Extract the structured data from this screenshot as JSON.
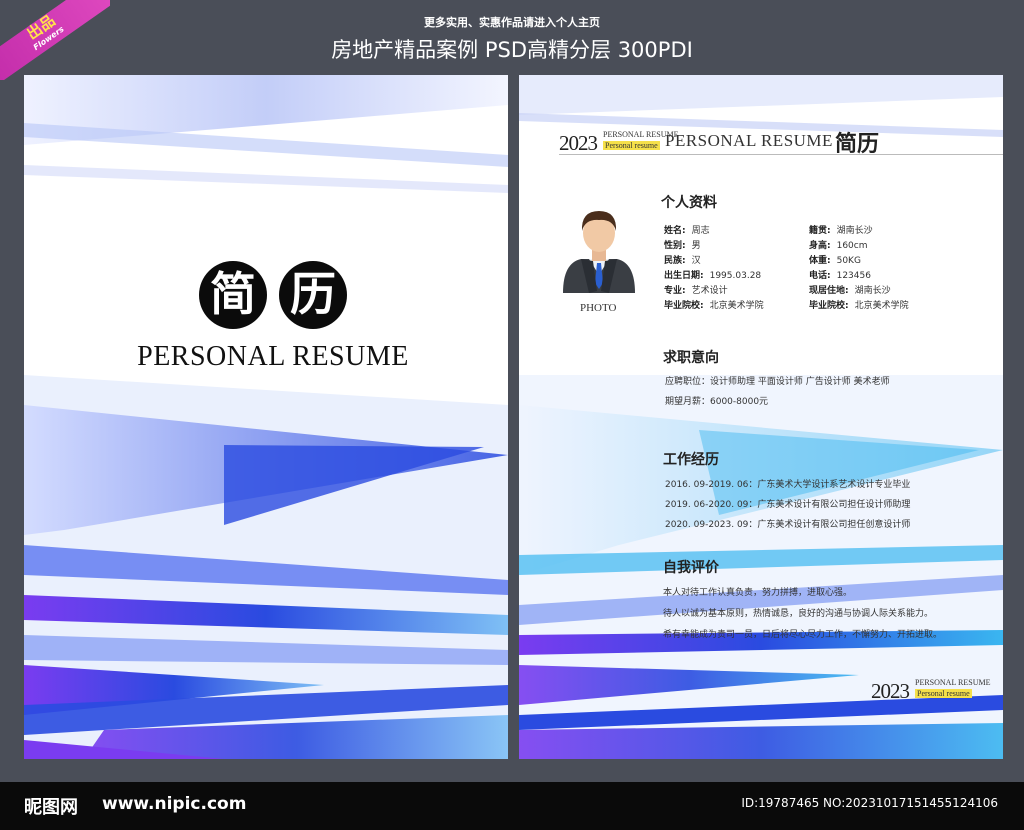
{
  "header": {
    "ribbon_main": "出品",
    "ribbon_sub": "Flowers",
    "subtitle": "更多实用、实惠作品请进入个人主页",
    "title": "房地产精品案例 PSD高精分层 300PDI"
  },
  "cover": {
    "char1": "简",
    "char2": "历",
    "subtitle": "PERSONAL RESUME"
  },
  "resume": {
    "year": "2023",
    "tag_line1": "PERSONAL RESUME",
    "tag_line2": "Personal resume",
    "title": "PERSONAL RESUME",
    "title_cn": "简历",
    "photo_label": "PHOTO",
    "profile": {
      "heading": "个人资料",
      "left": [
        {
          "label": "姓名:",
          "value": "周志"
        },
        {
          "label": "性别:",
          "value": "男"
        },
        {
          "label": "民族:",
          "value": "汉"
        },
        {
          "label": "出生日期:",
          "value": "1995.03.28"
        },
        {
          "label": "专业:",
          "value": "艺术设计"
        },
        {
          "label": "毕业院校:",
          "value": "北京美术学院"
        }
      ],
      "right": [
        {
          "label": "籍贯:",
          "value": "湖南长沙"
        },
        {
          "label": "身高:",
          "value": "160cm"
        },
        {
          "label": "体重:",
          "value": "50KG"
        },
        {
          "label": "电话:",
          "value": "123456"
        },
        {
          "label": "现居住地:",
          "value": "湖南长沙"
        },
        {
          "label": "毕业院校:",
          "value": "北京美术学院"
        }
      ]
    },
    "job": {
      "heading": "求职意向",
      "line1": "应聘职位：设计师助理  平面设计师  广告设计师  美术老师",
      "line2": "期望月薪：6000-8000元"
    },
    "work": {
      "heading": "工作经历",
      "items": [
        "2016. 09-2019. 06：广东美术大学设计系艺术设计专业毕业",
        "2019. 06-2020. 09：广东美术设计有限公司担任设计师助理",
        "2020. 09-2023. 09：广东美术设计有限公司担任创意设计师"
      ]
    },
    "self": {
      "heading": "自我评价",
      "items": [
        "本人对待工作认真负责，努力拼搏，进取心强。",
        "待人以诚为基本原则，热情诚恳，良好的沟通与协调人际关系能力。",
        "希有幸能成为贵司一员，日后将尽心尽力工作，不懈努力、开拓进取。"
      ]
    },
    "footer_year": "2023",
    "footer_tag_line1": "PERSONAL RESUME",
    "footer_tag_line2": "Personal resume"
  },
  "footer": {
    "logo": "昵图网",
    "url": "www.nipic.com",
    "id_text": "ID:19787465 NO:20231017151455124106"
  },
  "colors": {
    "accent_blue": "#2a4be0",
    "violet": "#7a3cf0",
    "cyan": "#3ab6f0"
  }
}
